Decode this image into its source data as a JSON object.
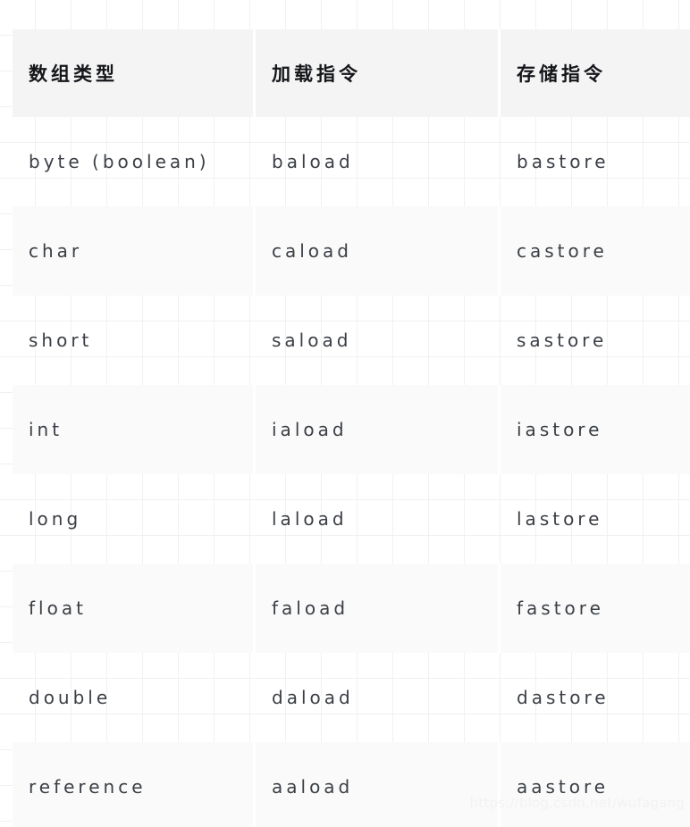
{
  "table": {
    "columns": [
      {
        "key": "array_type",
        "label": "数组类型"
      },
      {
        "key": "load_instruction",
        "label": "加载指令"
      },
      {
        "key": "store_instruction",
        "label": "存储指令"
      }
    ],
    "rows": [
      {
        "array_type": "byte (boolean)",
        "load_instruction": "baload",
        "store_instruction": "bastore",
        "striped": false
      },
      {
        "array_type": "char",
        "load_instruction": "caload",
        "store_instruction": "castore",
        "striped": true
      },
      {
        "array_type": "short",
        "load_instruction": "saload",
        "store_instruction": "sastore",
        "striped": false
      },
      {
        "array_type": "int",
        "load_instruction": "iaload",
        "store_instruction": "iastore",
        "striped": true
      },
      {
        "array_type": "long",
        "load_instruction": "laload",
        "store_instruction": "lastore",
        "striped": false
      },
      {
        "array_type": "float",
        "load_instruction": "faload",
        "store_instruction": "fastore",
        "striped": true
      },
      {
        "array_type": "double",
        "load_instruction": "daload",
        "store_instruction": "dastore",
        "striped": false
      },
      {
        "array_type": "reference",
        "load_instruction": "aaload",
        "store_instruction": "aastore",
        "striped": true
      }
    ]
  },
  "watermark": {
    "text": "https://blog.csdn.net/wufagang"
  },
  "colors": {
    "header_background": "#f4f4f4",
    "header_text": "#14161a",
    "body_text": "#3b3f45",
    "stripe_background": "#fafafa",
    "grid_line": "#f1f1f1",
    "page_background": "#ffffff",
    "watermark_text": "#f2f2f2"
  }
}
